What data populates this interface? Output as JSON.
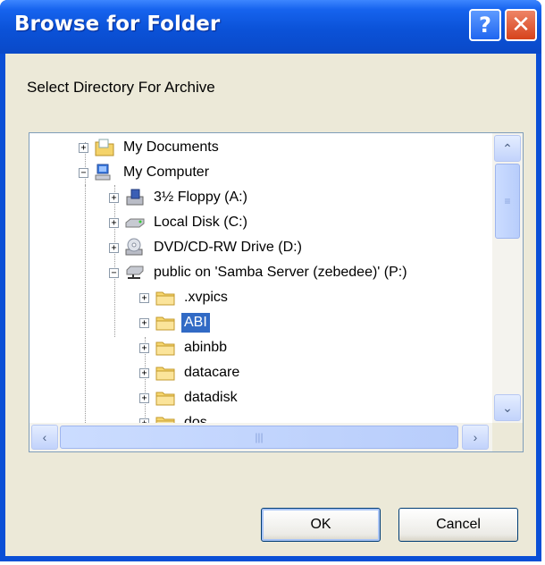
{
  "window": {
    "title": "Browse for Folder"
  },
  "titlebar": {
    "help_label": "?",
    "close_label": "✕"
  },
  "dialog": {
    "prompt": "Select Directory For Archive"
  },
  "tree": {
    "items": [
      {
        "label": "My Documents",
        "icon": "my-documents-icon",
        "expander": "+",
        "selected": false
      },
      {
        "label": "My Computer",
        "icon": "my-computer-icon",
        "expander": "−",
        "selected": false
      },
      {
        "label": "3½ Floppy (A:)",
        "icon": "floppy-drive-icon",
        "expander": "+",
        "selected": false
      },
      {
        "label": "Local Disk (C:)",
        "icon": "hard-disk-icon",
        "expander": "+",
        "selected": false
      },
      {
        "label": "DVD/CD-RW Drive (D:)",
        "icon": "cd-drive-icon",
        "expander": "+",
        "selected": false
      },
      {
        "label": "public on 'Samba Server (zebedee)' (P:)",
        "icon": "network-drive-icon",
        "expander": "−",
        "selected": false
      },
      {
        "label": ".xvpics",
        "icon": "folder-icon",
        "expander": "+",
        "selected": false
      },
      {
        "label": "ABI",
        "icon": "folder-icon",
        "expander": "+",
        "selected": true
      },
      {
        "label": "abinbb",
        "icon": "folder-icon",
        "expander": "+",
        "selected": false
      },
      {
        "label": "datacare",
        "icon": "folder-icon",
        "expander": "+",
        "selected": false
      },
      {
        "label": "datadisk",
        "icon": "folder-icon",
        "expander": "+",
        "selected": false
      },
      {
        "label": "dos",
        "icon": "folder-icon",
        "expander": "+",
        "selected": false
      }
    ]
  },
  "scrollbars": {
    "up": "⌃",
    "down": "⌄",
    "left": "‹",
    "right": "›",
    "grip_v": "≡",
    "grip_h": "|||"
  },
  "buttons": {
    "ok": "OK",
    "cancel": "Cancel"
  },
  "colors": {
    "title_bar": "#0a4fd6",
    "selection": "#316ac5",
    "dialog_bg": "#ece9d8"
  }
}
